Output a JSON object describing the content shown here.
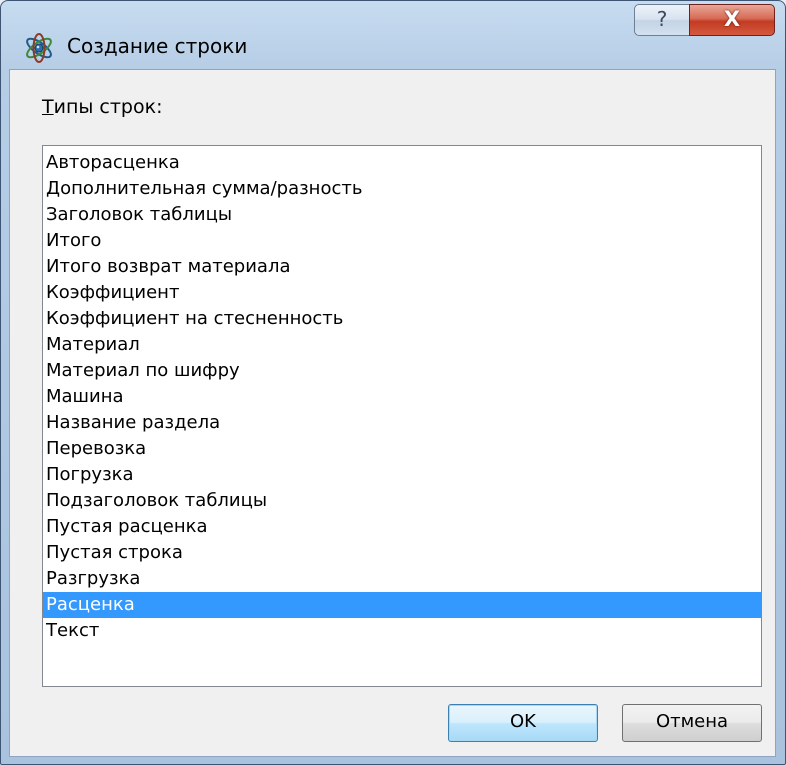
{
  "window": {
    "title": "Создание строки",
    "icon": "atom-icon",
    "help_label": "?",
    "close_label": "X"
  },
  "list": {
    "label_mnemonic": "Т",
    "label_rest": "ипы строк:",
    "selected_index": 17,
    "items": [
      "Авторасценка",
      "Дополнительная сумма/разность",
      "Заголовок таблицы",
      "Итого",
      "Итого возврат материала",
      "Коэффициент",
      "Коэффициент на стесненность",
      "Материал",
      "Материал по шифру",
      "Машина",
      "Название раздела",
      "Перевозка",
      "Погрузка",
      "Подзаголовок таблицы",
      "Пустая расценка",
      "Пустая строка",
      "Разгрузка",
      "Расценка",
      "Текст"
    ]
  },
  "buttons": {
    "ok": "OK",
    "cancel": "Отмена"
  },
  "colors": {
    "selection": "#3399ff",
    "close_button": "#c23b22",
    "title_bar": "#b6cde6"
  }
}
